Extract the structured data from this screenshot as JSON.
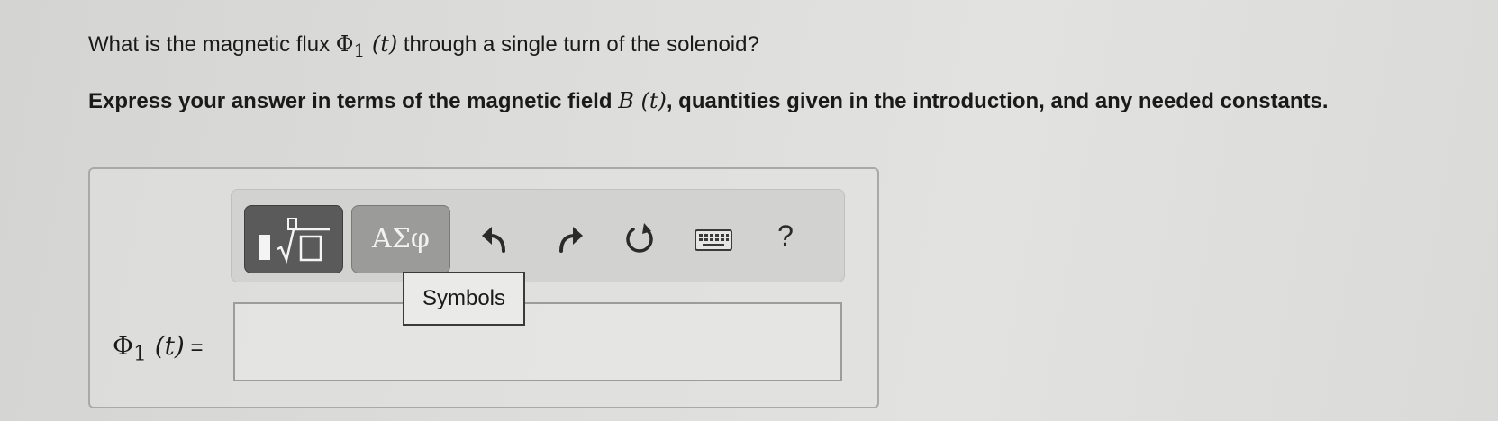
{
  "question": {
    "before": "What is the magnetic flux ",
    "symbol": "Φ",
    "subscript": "1",
    "arg": " (t)",
    "after": " through a single turn of the solenoid?"
  },
  "instruction": {
    "before": "Express your answer in terms of the magnetic field ",
    "field_symbol": "B",
    "field_arg": " (t)",
    "after": ", quantities given in the introduction, and any needed constants."
  },
  "toolbar": {
    "templates_icon": "templates-sqrt-icon",
    "symbols_label": "ΑΣφ",
    "undo_icon": "undo-icon",
    "redo_icon": "redo-icon",
    "reset_icon": "reset-icon",
    "keyboard_icon": "keyboard-icon",
    "help_label": "?"
  },
  "tooltip": {
    "text": "Symbols"
  },
  "answer": {
    "label_symbol": "Φ",
    "label_subscript": "1",
    "label_arg": " (t)",
    "label_equals": " =",
    "value": ""
  },
  "colors": {
    "background": "#dcdcda",
    "templates_button": "#5a5a5a",
    "symbols_button": "#9b9b99",
    "toolbar": "#d2d2d0",
    "text": "#1a1a1a"
  }
}
